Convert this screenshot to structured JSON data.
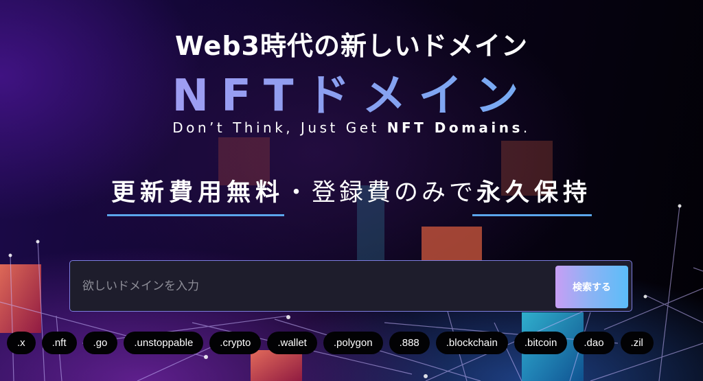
{
  "hero": {
    "headline": "Web3時代の新しいドメイン",
    "title": "NFTドメイン",
    "tagline_prefix": "Don’t Think, Just Get ",
    "tagline_bold": "NFT Domains",
    "tagline_suffix": ".",
    "subhead": {
      "part1": "更新費用無料",
      "part2": "・登録費のみで",
      "part3": "永久保持"
    }
  },
  "search": {
    "placeholder": "欲しいドメインを入力",
    "value": "",
    "button_label": "検索する"
  },
  "tlds": [
    ".x",
    ".nft",
    ".go",
    ".unstoppable",
    ".crypto",
    ".wallet",
    ".polygon",
    ".888",
    ".blockchain",
    ".bitcoin",
    ".dao",
    ".zil"
  ],
  "colors": {
    "accent_underline": "#5ba6ec",
    "title_gradient_start": "#b59bf5",
    "title_gradient_end": "#64b6f5",
    "button_gradient_start": "#c79ef4",
    "button_gradient_end": "#5bbdf8",
    "search_bg": "#1e1d2c",
    "tag_bg": "#020204"
  }
}
